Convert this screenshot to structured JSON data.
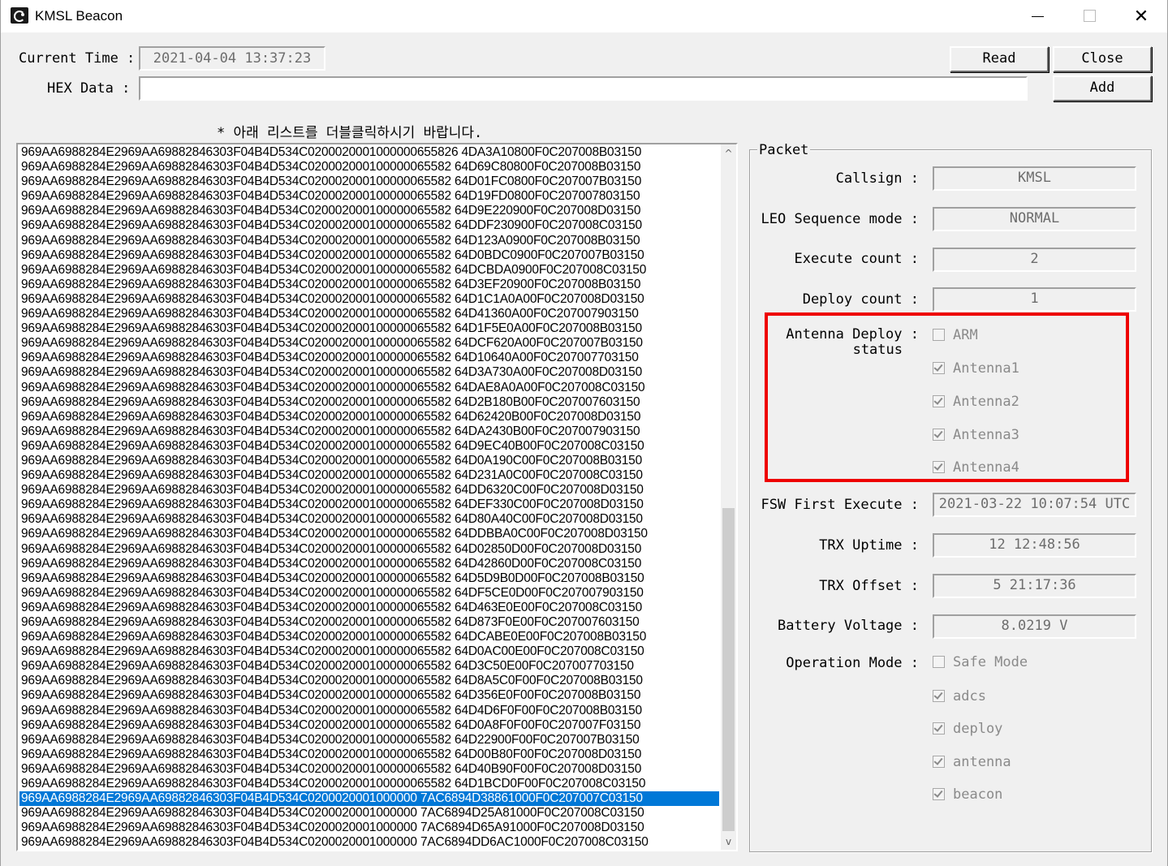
{
  "window": {
    "title": "KMSL Beacon",
    "close_glyph": "✕"
  },
  "header": {
    "current_time_label": "Current Time :",
    "current_time_value": "2021-04-04 13:37:23",
    "hex_data_label": "HEX Data :",
    "hex_data_value": "",
    "read_button": "Read",
    "close_button": "Close",
    "add_button": "Add"
  },
  "hint": "* 아래 리스트를 더블클릭하시기 바랍니다.",
  "list": {
    "rows": [
      "969AA6988284E2969AA69882846303F04B4D534C0200020001000000655826 4DA3A10800F0C207008B03150",
      "969AA6988284E2969AA69882846303F04B4D534C020002000100000065582 64D69C80800F0C207008B03150",
      "969AA6988284E2969AA69882846303F04B4D534C020002000100000065582 64D01FC0800F0C207007B03150",
      "969AA6988284E2969AA69882846303F04B4D534C020002000100000065582 64D19FD0800F0C207007803150",
      "969AA6988284E2969AA69882846303F04B4D534C020002000100000065582 64D9E220900F0C207008D03150",
      "969AA6988284E2969AA69882846303F04B4D534C020002000100000065582 64DDF230900F0C207008C03150",
      "969AA6988284E2969AA69882846303F04B4D534C020002000100000065582 64D123A0900F0C207008B03150",
      "969AA6988284E2969AA69882846303F04B4D534C020002000100000065582 64D0BDC0900F0C207007B03150",
      "969AA6988284E2969AA69882846303F04B4D534C020002000100000065582 64DCBDA0900F0C207008C03150",
      "969AA6988284E2969AA69882846303F04B4D534C020002000100000065582 64D3EF20900F0C207008B03150",
      "969AA6988284E2969AA69882846303F04B4D534C020002000100000065582 64D1C1A0A00F0C207008D03150",
      "969AA6988284E2969AA69882846303F04B4D534C020002000100000065582 64D41360A00F0C207007903150",
      "969AA6988284E2969AA69882846303F04B4D534C020002000100000065582 64D1F5E0A00F0C207008B03150",
      "969AA6988284E2969AA69882846303F04B4D534C020002000100000065582 64DCF620A00F0C207007B03150",
      "969AA6988284E2969AA69882846303F04B4D534C020002000100000065582 64D10640A00F0C207007703150",
      "969AA6988284E2969AA69882846303F04B4D534C020002000100000065582 64D3A730A00F0C207008D03150",
      "969AA6988284E2969AA69882846303F04B4D534C020002000100000065582 64DAE8A0A00F0C207008C03150",
      "969AA6988284E2969AA69882846303F04B4D534C020002000100000065582 64D2B180B00F0C207007603150",
      "969AA6988284E2969AA69882846303F04B4D534C020002000100000065582 64D62420B00F0C207008D03150",
      "969AA6988284E2969AA69882846303F04B4D534C020002000100000065582 64DA2430B00F0C207007903150",
      "969AA6988284E2969AA69882846303F04B4D534C020002000100000065582 64D9EC40B00F0C207008C03150",
      "969AA6988284E2969AA69882846303F04B4D534C020002000100000065582 64D0A190C00F0C207008B03150",
      "969AA6988284E2969AA69882846303F04B4D534C020002000100000065582 64D231A0C00F0C207008C03150",
      "969AA6988284E2969AA69882846303F04B4D534C020002000100000065582 64DD6320C00F0C207008D03150",
      "969AA6988284E2969AA69882846303F04B4D534C020002000100000065582 64DEF330C00F0C207008D03150",
      "969AA6988284E2969AA69882846303F04B4D534C020002000100000065582 64D80A40C00F0C207008D03150",
      "969AA6988284E2969AA69882846303F04B4D534C020002000100000065582 64DDBBA0C00F0C207008D03150",
      "969AA6988284E2969AA69882846303F04B4D534C020002000100000065582 64D02850D00F0C207008D03150",
      "969AA6988284E2969AA69882846303F04B4D534C020002000100000065582 64D42860D00F0C207008C03150",
      "969AA6988284E2969AA69882846303F04B4D534C020002000100000065582 64D5D9B0D00F0C207008B03150",
      "969AA6988284E2969AA69882846303F04B4D534C020002000100000065582 64DF5CE0D00F0C207007903150",
      "969AA6988284E2969AA69882846303F04B4D534C020002000100000065582 64D463E0E00F0C207008C03150",
      "969AA6988284E2969AA69882846303F04B4D534C020002000100000065582 64D873F0E00F0C207007603150",
      "969AA6988284E2969AA69882846303F04B4D534C020002000100000065582 64DCABE0E00F0C207008B03150",
      "969AA6988284E2969AA69882846303F04B4D534C020002000100000065582 64D0AC00E00F0C207008C03150",
      "969AA6988284E2969AA69882846303F04B4D534C020002000100000065582 64D3C50E00F0C207007703150",
      "969AA6988284E2969AA69882846303F04B4D534C020002000100000065582 64D8A5C0F00F0C207008B03150",
      "969AA6988284E2969AA69882846303F04B4D534C020002000100000065582 64D356E0F00F0C207008B03150",
      "969AA6988284E2969AA69882846303F04B4D534C020002000100000065582 64D4D6F0F00F0C207008B03150",
      "969AA6988284E2969AA69882846303F04B4D534C020002000100000065582 64D0A8F0F00F0C207007F03150",
      "969AA6988284E2969AA69882846303F04B4D534C020002000100000065582 64D22900F00F0C207007B03150",
      "969AA6988284E2969AA69882846303F04B4D534C020002000100000065582 64D00B80F00F0C207008D03150",
      "969AA6988284E2969AA69882846303F04B4D534C020002000100000065582 64D40B90F00F0C207008D03150",
      "969AA6988284E2969AA69882846303F04B4D534C020002000100000065582 64D1BCD0F00F0C207008C03150",
      "969AA6988284E2969AA69882846303F04B4D534C0200020001000000 7AC6894D38861000F0C207007C03150",
      "969AA6988284E2969AA69882846303F04B4D534C0200020001000000 7AC6894D25A81000F0C207008C03150",
      "969AA6988284E2969AA69882846303F04B4D534C0200020001000000 7AC6894D65A91000F0C207008D03150",
      "969AA6988284E2969AA69882846303F04B4D534C0200020001000000 7AC6894DD6AC1000F0C207008C03150"
    ],
    "selected_index": 44,
    "scroll_up_glyph": "^",
    "scroll_down_glyph": "v"
  },
  "packet": {
    "group_title": "Packet",
    "callsign_label": "Callsign :",
    "callsign_value": "KMSL",
    "leo_label": "LEO Sequence mode :",
    "leo_value": "NORMAL",
    "execute_label": "Execute count :",
    "execute_value": "2",
    "deploy_label": "Deploy count :",
    "deploy_value": "1",
    "antenna_label_1": "Antenna Deploy :",
    "antenna_label_2": "status",
    "antenna_checks": [
      {
        "label": "ARM",
        "checked": false
      },
      {
        "label": "Antenna1",
        "checked": true
      },
      {
        "label": "Antenna2",
        "checked": true
      },
      {
        "label": "Antenna3",
        "checked": true
      },
      {
        "label": "Antenna4",
        "checked": true
      }
    ],
    "fsw_label": "FSW First Execute :",
    "fsw_value": "2021-03-22 10:07:54 UTC",
    "trx_uptime_label": "TRX Uptime :",
    "trx_uptime_value": "12 12:48:56",
    "trx_offset_label": "TRX Offset :",
    "trx_offset_value": "5 21:17:36",
    "battery_label": "Battery Voltage :",
    "battery_value": "8.0219 V",
    "operation_label": "Operation Mode :",
    "operation_checks": [
      {
        "label": "Safe Mode",
        "checked": false
      },
      {
        "label": "adcs",
        "checked": true
      },
      {
        "label": "deploy",
        "checked": true
      },
      {
        "label": "antenna",
        "checked": true
      },
      {
        "label": "beacon",
        "checked": true
      }
    ]
  },
  "colors": {
    "highlight": "#ee0000",
    "selection": "#0078d7"
  }
}
